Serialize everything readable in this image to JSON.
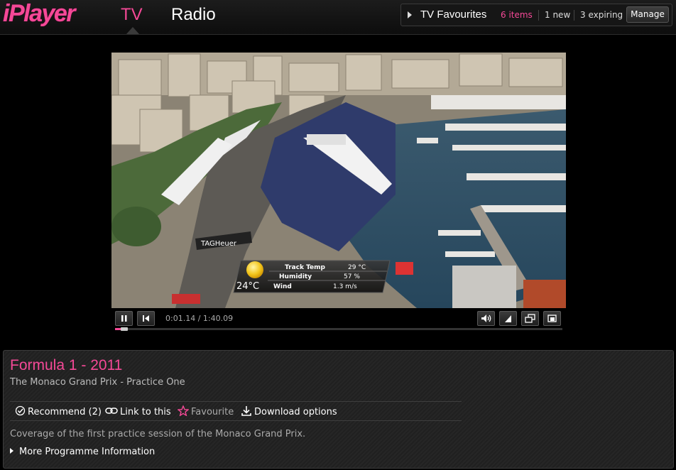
{
  "header": {
    "logo": "iPlayer",
    "nav": {
      "tv": "TV",
      "radio": "Radio"
    },
    "favourites": {
      "title": "TV Favourites",
      "items": "6 items",
      "new": "1 new",
      "expiring": "3 expiring",
      "manage": "Manage"
    }
  },
  "player": {
    "time": "0:01.14 / 1:40.09",
    "progress_fraction": 0.012,
    "overlay": {
      "temperature": "24°C",
      "rows": [
        {
          "label": "Track Temp",
          "value": "29 °C"
        },
        {
          "label": "Humidity",
          "value": "57 %"
        },
        {
          "label": "Wind",
          "value": "1.3 m/s"
        }
      ],
      "sign": "TAGHeuer"
    }
  },
  "programme": {
    "title": "Formula 1 - 2011",
    "subtitle": "The Monaco Grand Prix - Practice One",
    "actions": {
      "recommend": "Recommend (2)",
      "link": "Link to this",
      "favourite": "Favourite",
      "download": "Download options"
    },
    "description": "Coverage of the first practice session of the Monaco Grand Prix.",
    "more": "More Programme Information"
  },
  "colors": {
    "accent": "#f54997"
  },
  "icons": [
    "play-arrow-icon",
    "pause-icon",
    "skip-back-icon",
    "volume-icon",
    "resize-icon",
    "popout-icon",
    "fullscreen-icon",
    "recommend-icon",
    "link-icon",
    "star-icon",
    "download-icon",
    "expand-arrow-icon"
  ]
}
